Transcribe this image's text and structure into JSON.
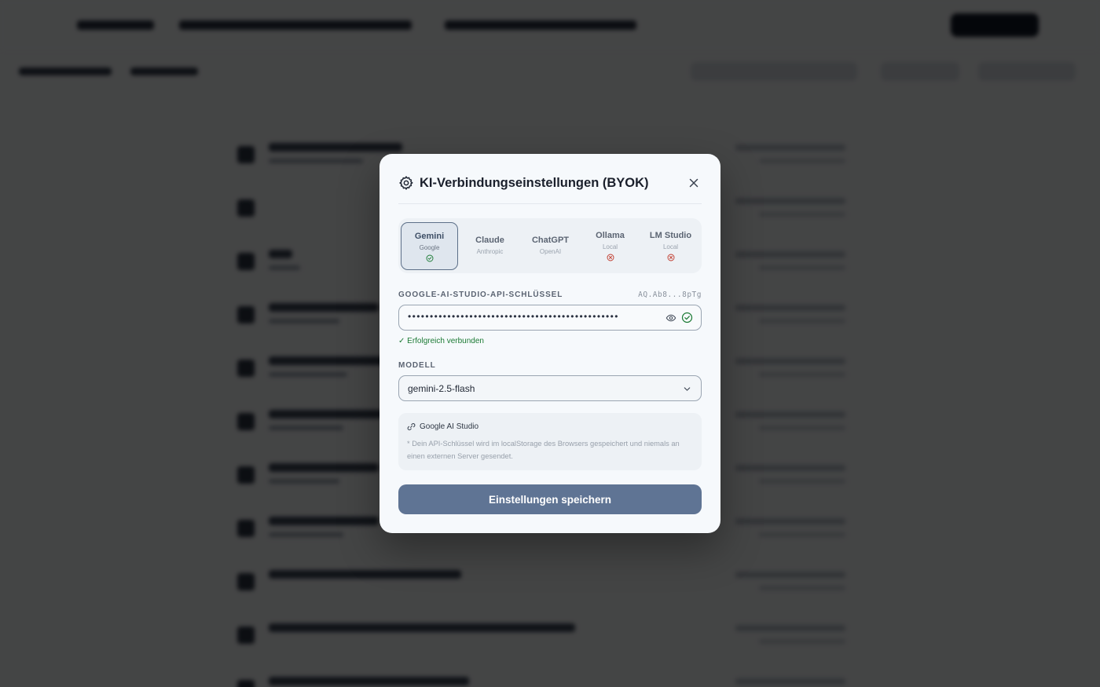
{
  "modal": {
    "title": "KI-Verbindungseinstellungen (BYOK)",
    "providers": [
      {
        "name": "Gemini",
        "sub": "Google",
        "status": "connected",
        "active": true
      },
      {
        "name": "Claude",
        "sub": "Anthropic",
        "status": "none",
        "active": false
      },
      {
        "name": "ChatGPT",
        "sub": "OpenAI",
        "status": "none",
        "active": false
      },
      {
        "name": "Ollama",
        "sub": "Local",
        "status": "error",
        "active": false
      },
      {
        "name": "LM Studio",
        "sub": "Local",
        "status": "error",
        "active": false
      }
    ],
    "api_key": {
      "label": "GOOGLE-AI-STUDIO-API-SCHLÜSSEL",
      "masked_hint": "AQ.Ab8...8pTg",
      "value": "••••••••••••••••••••••••••••••••••••••••••••••••"
    },
    "success_message": "✓ Erfolgreich verbunden",
    "model": {
      "label": "MODELL",
      "selected": "gemini-2.5-flash"
    },
    "info": {
      "link_text": "Google AI Studio",
      "note": "* Dein API-Schlüssel wird im localStorage des Browsers gespeichert und niemals an einen externen Server gesendet."
    },
    "save_label": "Einstellungen speichern"
  },
  "colors": {
    "accent": "#5f7494",
    "success": "#1b7a34",
    "error": "#c0392b"
  },
  "icons": {
    "settings": "gear-icon",
    "close": "close-icon",
    "visibility": "eye-icon",
    "connected": "check-circle-icon",
    "error": "x-circle-icon",
    "dropdown": "chevron-down-icon",
    "link": "link-icon"
  }
}
